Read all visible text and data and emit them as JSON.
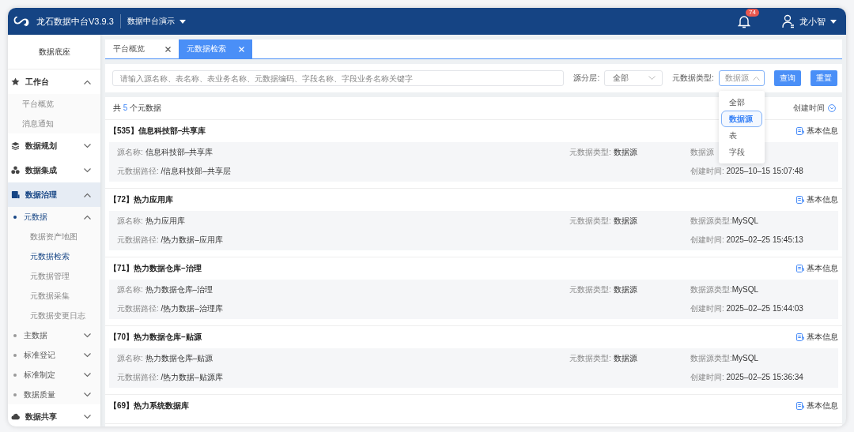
{
  "header": {
    "title": "龙石数据中台V3.9.3",
    "workspace": "数据中台演示",
    "notifications": "74",
    "user": "龙小智"
  },
  "sidebar": {
    "title": "数据底座",
    "items": [
      {
        "label": "工作台",
        "expanded": true,
        "selected": false,
        "children": [
          {
            "label": "平台概览",
            "selected": false
          },
          {
            "label": "消息通知",
            "selected": false
          }
        ]
      },
      {
        "label": "数据规划",
        "expanded": false,
        "selected": false
      },
      {
        "label": "数据集成",
        "expanded": false,
        "selected": false
      },
      {
        "label": "数据治理",
        "expanded": true,
        "selected": true,
        "children": [
          {
            "label": "元数据",
            "expanded": true,
            "selected": true,
            "children": [
              {
                "label": "数据资产地图",
                "selected": false
              },
              {
                "label": "元数据检索",
                "selected": true
              },
              {
                "label": "元数据管理",
                "selected": false
              },
              {
                "label": "元数据采集",
                "selected": false
              },
              {
                "label": "元数据变更日志",
                "selected": false
              }
            ]
          },
          {
            "label": "主数据",
            "expanded": false,
            "selected": false
          },
          {
            "label": "标准登记",
            "expanded": false,
            "selected": false
          },
          {
            "label": "标准制定",
            "expanded": false,
            "selected": false
          },
          {
            "label": "数据质量",
            "expanded": false,
            "selected": false
          }
        ]
      },
      {
        "label": "数据共享",
        "expanded": false,
        "selected": false
      }
    ]
  },
  "tabs": [
    {
      "label": "平台概览",
      "selected": false
    },
    {
      "label": "元数据检索",
      "selected": true
    }
  ],
  "filters": {
    "search": {
      "placeholder": "请输入源名称、表名称、表业务名称、元数据编码、字段名称、字段业务名称关键字"
    },
    "layer": {
      "label": "源分层:",
      "value": "全部"
    },
    "type": {
      "label": "元数据类型:",
      "value": "数据源",
      "open": true,
      "options": [
        {
          "label": "全部",
          "selected": false
        },
        {
          "label": "数据源",
          "selected": true
        },
        {
          "label": "表",
          "selected": false
        },
        {
          "label": "字段",
          "selected": false
        }
      ]
    },
    "buttons": [
      "查询",
      "重置"
    ]
  },
  "results": {
    "count_prefix": "共",
    "count": "5",
    "count_suffix": "个元数据",
    "sort": "创建时间",
    "records": [
      {
        "title": "【535】信息科技部–共享库",
        "action": "基本信息",
        "source_name": {
          "label": "源名称:",
          "value": "信息科技部–共享库"
        },
        "metadata_type": {
          "label": "元数据类型:",
          "value": "数据源"
        },
        "datasource_type": {
          "label": "数据源"
        },
        "path": {
          "label": "元数据路径:",
          "value": "/信息科技部–共享层"
        },
        "created": {
          "label": "创建时间:",
          "value": "2025–10–15 15:07:48"
        }
      },
      {
        "title": "【72】热力应用库",
        "action": "基本信息",
        "source_name": {
          "label": "源名称:",
          "value": "热力应用库"
        },
        "metadata_type": {
          "label": "元数据类型:",
          "value": "数据源"
        },
        "datasource_type": {
          "label": "数据源类型:",
          "value": "MySQL"
        },
        "path": {
          "label": "元数据路径:",
          "value": "/热力数据–应用库"
        },
        "created": {
          "label": "创建时间:",
          "value": "2025–02–25 15:45:13"
        }
      },
      {
        "title": "【71】热力数据仓库–治理",
        "action": "基本信息",
        "source_name": {
          "label": "源名称:",
          "value": "热力数据仓库–治理"
        },
        "metadata_type": {
          "label": "元数据类型:",
          "value": "数据源"
        },
        "datasource_type": {
          "label": "数据源类型:",
          "value": "MySQL"
        },
        "path": {
          "label": "元数据路径:",
          "value": "/热力数据–治理库"
        },
        "created": {
          "label": "创建时间:",
          "value": "2025–02–25 15:44:03"
        }
      },
      {
        "title": "【70】热力数据仓库–贴源",
        "action": "基本信息",
        "source_name": {
          "label": "源名称:",
          "value": "热力数据仓库–贴源"
        },
        "metadata_type": {
          "label": "元数据类型:",
          "value": "数据源"
        },
        "datasource_type": {
          "label": "数据源类型:",
          "value": "MySQL"
        },
        "path": {
          "label": "元数据路径:",
          "value": "/热力数据–贴源库"
        },
        "created": {
          "label": "创建时间:",
          "value": "2025–02–25 15:36:34"
        }
      },
      {
        "title": "【69】热力系统数据库",
        "action": "基本信息"
      }
    ]
  }
}
